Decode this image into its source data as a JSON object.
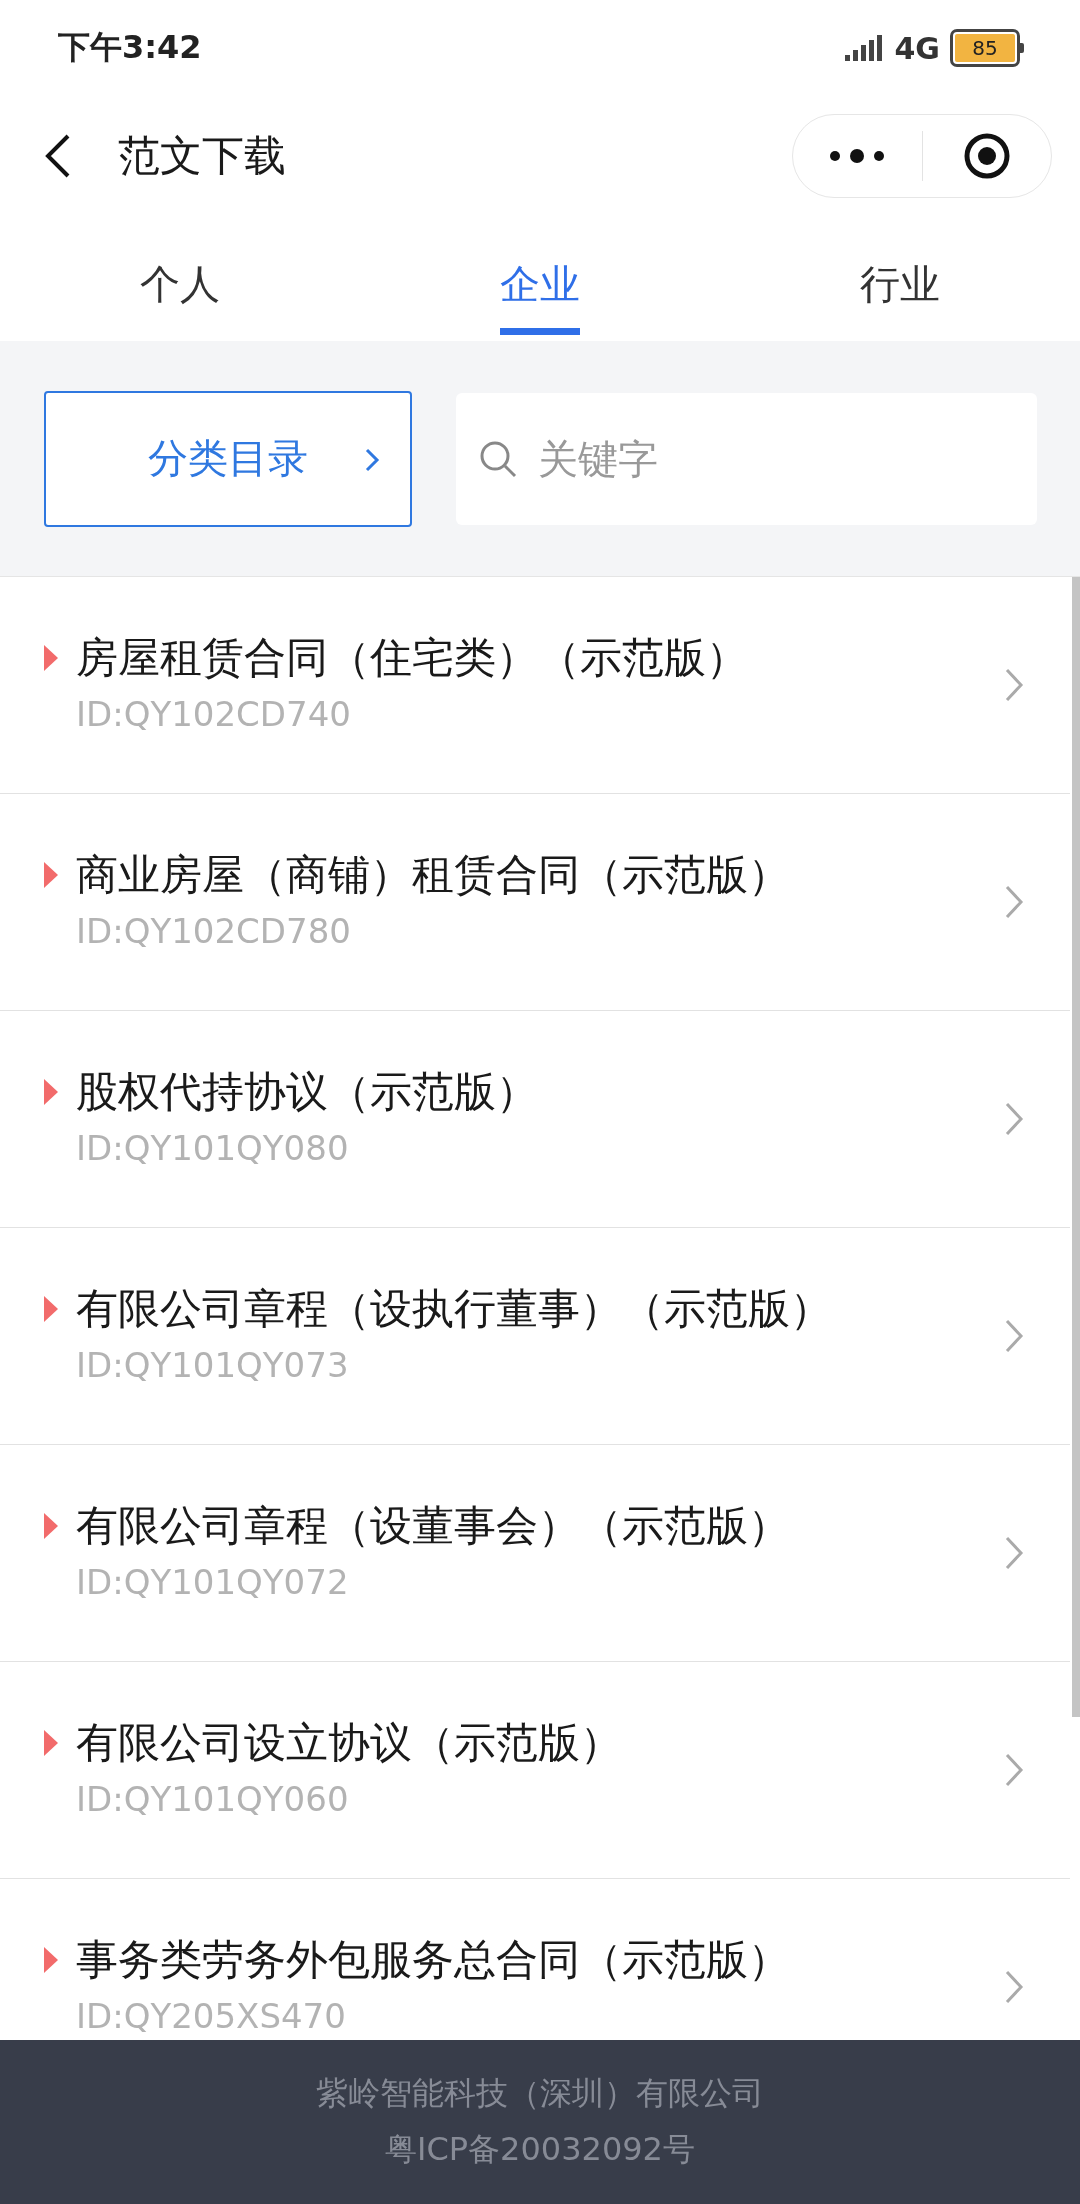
{
  "status_bar": {
    "time": "下午3:42",
    "network": "4G",
    "battery": "85"
  },
  "header": {
    "title": "范文下载"
  },
  "tabs": [
    {
      "label": "个人",
      "selected": false
    },
    {
      "label": "企业",
      "selected": true
    },
    {
      "label": "行业",
      "selected": false
    }
  ],
  "category_button": {
    "label": "分类目录"
  },
  "search": {
    "placeholder": "关键字"
  },
  "documents": [
    {
      "title": "房屋租赁合同（住宅类）（示范版）",
      "id": "ID:QY102CD740"
    },
    {
      "title": "商业房屋（商铺）租赁合同（示范版）",
      "id": "ID:QY102CD780"
    },
    {
      "title": "股权代持协议（示范版）",
      "id": "ID:QY101QY080"
    },
    {
      "title": "有限公司章程（设执行董事）（示范版）",
      "id": "ID:QY101QY073"
    },
    {
      "title": "有限公司章程（设董事会）（示范版）",
      "id": "ID:QY101QY072"
    },
    {
      "title": "有限公司设立协议（示范版）",
      "id": "ID:QY101QY060"
    },
    {
      "title": "事务类劳务外包服务总合同（示范版）",
      "id": "ID:QY205XS470"
    }
  ],
  "footer": {
    "company": "紫岭智能科技（深圳）有限公司",
    "icp": "粤ICP备20032092号"
  }
}
